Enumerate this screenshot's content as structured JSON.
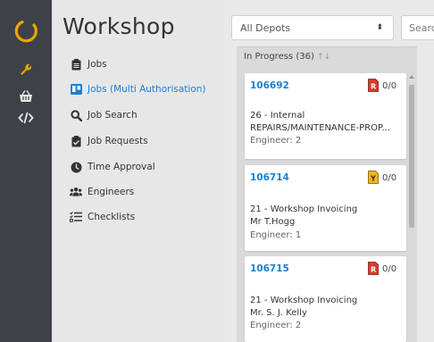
{
  "app": {
    "title": "Workshop"
  },
  "rail": {
    "icons": [
      "logo-icon",
      "wrench-icon",
      "basket-icon",
      "code-icon"
    ],
    "accent": "#f0a500"
  },
  "menu": {
    "items": [
      {
        "label": "Jobs",
        "icon": "clipboard-icon"
      },
      {
        "label": "Jobs (Multi Authorisation)",
        "icon": "board-icon",
        "active": true
      },
      {
        "label": "Job Search",
        "icon": "search-icon"
      },
      {
        "label": "Job Requests",
        "icon": "clipboard-check-icon"
      },
      {
        "label": "Time Approval",
        "icon": "clock-icon"
      },
      {
        "label": "Engineers",
        "icon": "users-icon"
      },
      {
        "label": "Checklists",
        "icon": "list-check-icon"
      }
    ]
  },
  "filters": {
    "depot": {
      "value": "All Depots",
      "caret": "⬍"
    },
    "search": {
      "placeholder": "Searc"
    }
  },
  "column": {
    "header": "In Progress (36)",
    "sort_icon": "↑↓",
    "cards": [
      {
        "id": "106692",
        "badge": "red",
        "count": "0/0",
        "line1": "26 - Internal",
        "line2": "REPAIRS/MAINTENANCE-PROP...",
        "engineer": "Engineer: 2"
      },
      {
        "id": "106714",
        "badge": "yellow",
        "count": "0/0",
        "line1": "21 - Workshop Invoicing",
        "line2": "Mr T.Hogg",
        "engineer": "Engineer: 1"
      },
      {
        "id": "106715",
        "badge": "red",
        "count": "0/0",
        "line1": "21 - Workshop Invoicing",
        "line2": "Mr. S. J. Kelly",
        "engineer": "Engineer: 2"
      }
    ]
  },
  "colors": {
    "link": "#1a7fd4",
    "badge_red": "#d93a2b",
    "badge_yellow": "#f2b51a",
    "rail": "#3c4248"
  }
}
